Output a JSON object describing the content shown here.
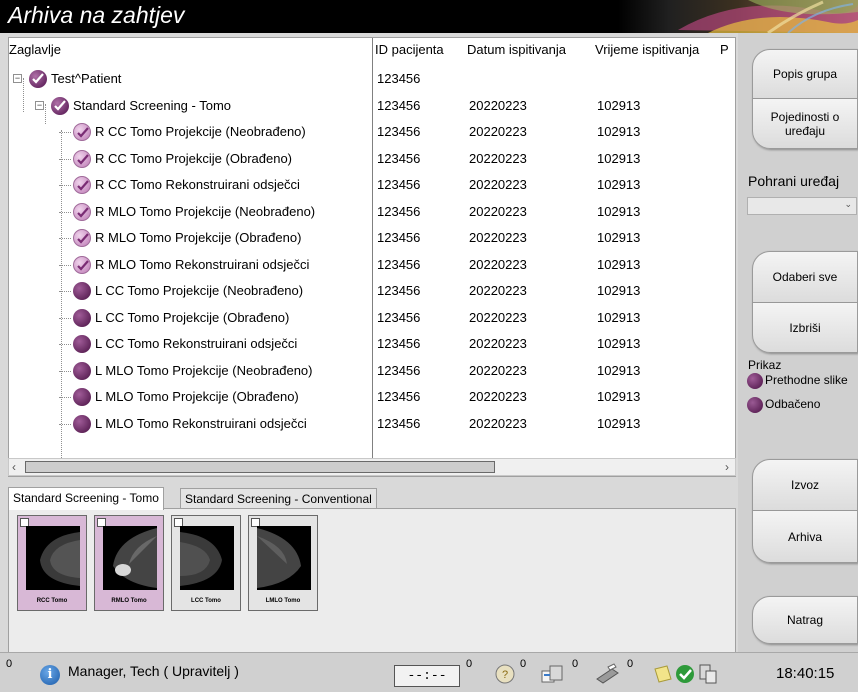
{
  "window": {
    "title": "Arhiva na zahtjev"
  },
  "grid": {
    "columns": [
      "Zaglavlje",
      "ID pacijenta",
      "Datum ispitivanja",
      "Vrijeme ispitivanja",
      "P"
    ],
    "rows": [
      {
        "name": "Test^Patient",
        "id": "123456",
        "date": "",
        "time": "",
        "status": "check"
      },
      {
        "name": "Standard Screening - Tomo",
        "id": "123456",
        "date": "20220223",
        "time": "102913",
        "status": "check"
      },
      {
        "name": "R CC Tomo  Projekcije (Neobrađeno)",
        "id": "123456",
        "date": "20220223",
        "time": "102913",
        "status": "checklight"
      },
      {
        "name": "R CC Tomo  Projekcije (Obrađeno)",
        "id": "123456",
        "date": "20220223",
        "time": "102913",
        "status": "checklight"
      },
      {
        "name": "R CC Tomo  Rekonstruirani odsječci",
        "id": "123456",
        "date": "20220223",
        "time": "102913",
        "status": "checklight"
      },
      {
        "name": "R MLO Tomo  Projekcije (Neobrađeno)",
        "id": "123456",
        "date": "20220223",
        "time": "102913",
        "status": "checklight"
      },
      {
        "name": "R MLO Tomo  Projekcije (Obrađeno)",
        "id": "123456",
        "date": "20220223",
        "time": "102913",
        "status": "checklight"
      },
      {
        "name": "R MLO Tomo  Rekonstruirani odsječci",
        "id": "123456",
        "date": "20220223",
        "time": "102913",
        "status": "checklight"
      },
      {
        "name": "L CC Tomo  Projekcije (Neobrađeno)",
        "id": "123456",
        "date": "20220223",
        "time": "102913",
        "status": "plain"
      },
      {
        "name": "L CC Tomo  Projekcije (Obrađeno)",
        "id": "123456",
        "date": "20220223",
        "time": "102913",
        "status": "plain"
      },
      {
        "name": "L CC Tomo  Rekonstruirani odsječci",
        "id": "123456",
        "date": "20220223",
        "time": "102913",
        "status": "plain"
      },
      {
        "name": "L MLO Tomo  Projekcije (Neobrađeno)",
        "id": "123456",
        "date": "20220223",
        "time": "102913",
        "status": "plain"
      },
      {
        "name": "L MLO Tomo  Projekcije (Obrađeno)",
        "id": "123456",
        "date": "20220223",
        "time": "102913",
        "status": "plain"
      },
      {
        "name": "L MLO Tomo  Rekonstruirani odsječci",
        "id": "123456",
        "date": "20220223",
        "time": "102913",
        "status": "plain"
      }
    ]
  },
  "tabs": [
    "Standard Screening - Tomo",
    "Standard Screening - Conventional"
  ],
  "thumbnails": [
    {
      "label": "RCC Tomo",
      "selected": true
    },
    {
      "label": "RMLO Tomo",
      "selected": true
    },
    {
      "label": "LCC Tomo",
      "selected": false
    },
    {
      "label": "LMLO Tomo",
      "selected": false
    }
  ],
  "right": {
    "groups_label": "Popis grupa",
    "device_details_label": "Pojedinosti o uređaju",
    "store_device_label": "Pohrani uređaj",
    "store_device_value": "",
    "select_all_label": "Odaberi sve",
    "delete_label": "Izbriši",
    "display_label": "Prikaz",
    "prior_images_label": "Prethodne slike",
    "rejected_label": "Odbačeno",
    "export_label": "Izvoz",
    "archive_label": "Arhiva",
    "back_label": "Natrag"
  },
  "taskbar": {
    "counter_left": "0",
    "user": "Manager, Tech ( Upravitelj )",
    "display": "--:--",
    "counters": [
      "0",
      "0",
      "0",
      "0",
      "0"
    ],
    "clock": "18:40:15"
  },
  "colors": {
    "accent": "#6a2c66",
    "light_check": "#c98fc2",
    "title_bg": "#000000"
  }
}
